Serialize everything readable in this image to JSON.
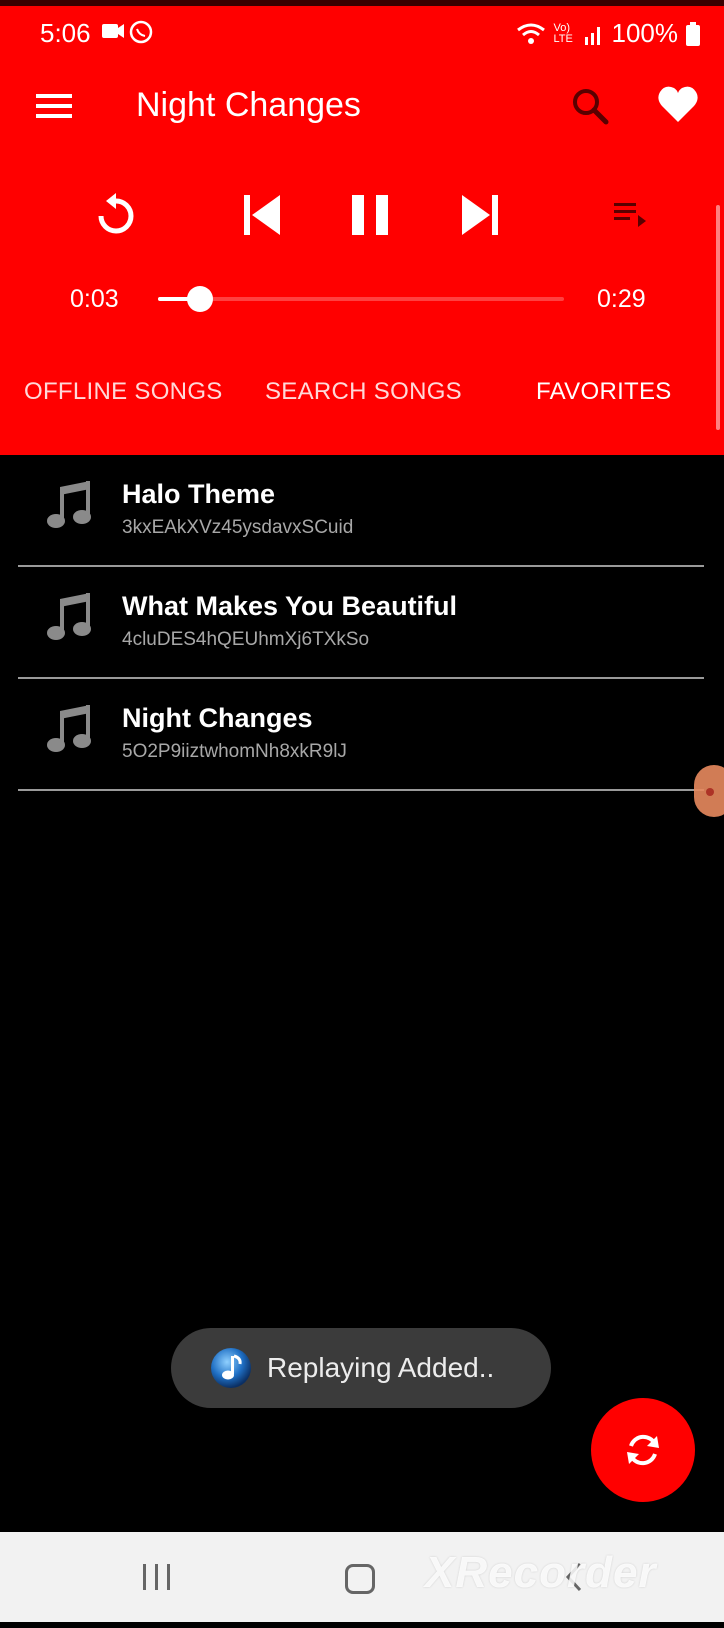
{
  "status_bar": {
    "time": "5:06",
    "battery": "100%",
    "signal_label": "Vo) LTE"
  },
  "toolbar": {
    "title": "Night Changes",
    "icons": [
      "menu-icon",
      "search-icon",
      "heart-icon"
    ]
  },
  "player": {
    "current_time": "0:03",
    "total_time": "0:29",
    "progress_fraction": 0.103,
    "controls": [
      "replay-icon",
      "skip-previous-icon",
      "pause-icon",
      "skip-next-icon",
      "queue-icon"
    ]
  },
  "tabs": [
    {
      "label": "OFFLINE SONGS"
    },
    {
      "label": "SEARCH SONGS"
    },
    {
      "label": "FAVORITES",
      "active": true
    }
  ],
  "songs": [
    {
      "title": "Halo Theme",
      "id": "3kxEAkXVz45ysdavxSCuid"
    },
    {
      "title": "What Makes You Beautiful",
      "id": "4cluDES4hQEUhmXj6TXkSo"
    },
    {
      "title": "Night Changes",
      "id": "5O2P9iiztwhomNh8xkR9lJ"
    }
  ],
  "toast": {
    "text": "Replaying Added.."
  },
  "fab": {
    "icon": "sync-icon"
  },
  "navbar": {
    "watermark": "XRecorder"
  },
  "colors": {
    "accent": "#ff0000",
    "background": "#000000",
    "toast_bg": "#3b3b3b",
    "navbar_bg": "#f2f2f2"
  }
}
